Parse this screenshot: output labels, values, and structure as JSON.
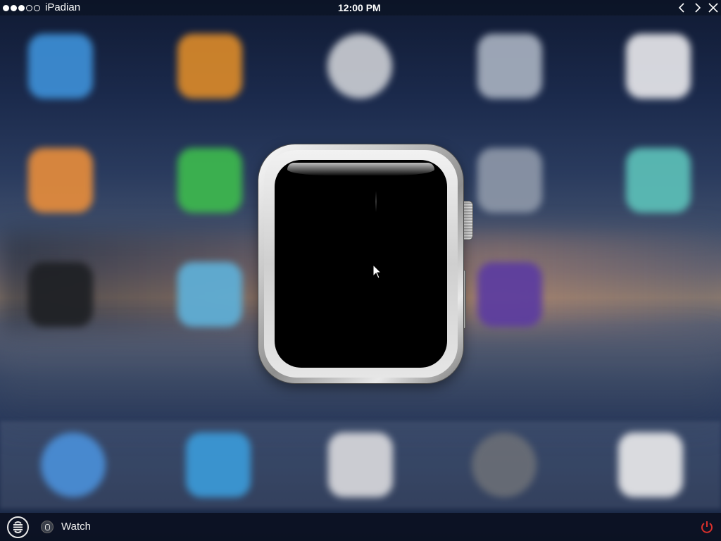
{
  "status_bar": {
    "signal_dots": [
      true,
      true,
      true,
      false,
      false
    ],
    "carrier": "iPadian",
    "time": "12:00 PM",
    "controls": [
      "chevron-left-icon",
      "chevron-right-icon",
      "close-icon"
    ]
  },
  "home_screen": {
    "icons": [
      {
        "name": "app-store-icon",
        "color": "#3d8fd6",
        "shape": "rounded"
      },
      {
        "name": "ibooks-icon",
        "color": "#d9892a",
        "shape": "rounded"
      },
      {
        "name": "clock-icon",
        "color": "#c9ccd2",
        "shape": "round"
      },
      {
        "name": "settings-icon",
        "color": "#a7b0bf",
        "shape": "rounded"
      },
      {
        "name": "health-icon",
        "color": "#e6e6ea",
        "shape": "rounded"
      },
      {
        "name": "mail-orange-icon",
        "color": "#e58c3c",
        "shape": "rounded"
      },
      {
        "name": "messages-icon",
        "color": "#3db94e",
        "shape": "rounded"
      },
      {
        "name": "blank-icon",
        "color": "#8d97a8",
        "shape": "rounded"
      },
      {
        "name": "clips-icon",
        "color": "#5cc0b8",
        "shape": "rounded"
      },
      {
        "name": "camera-icon",
        "color": "#1e2024",
        "shape": "rounded"
      },
      {
        "name": "weather-icon",
        "color": "#5fb0d8",
        "shape": "rounded"
      },
      {
        "name": "cloud-app-icon",
        "color": "#5c3ca0",
        "shape": "rounded"
      }
    ],
    "dock": [
      {
        "name": "safari-icon",
        "color": "#4a8fd8",
        "shape": "round"
      },
      {
        "name": "mail-icon",
        "color": "#3b9ad8",
        "shape": "rounded"
      },
      {
        "name": "apps-icon",
        "color": "#d8d8dc",
        "shape": "rounded"
      },
      {
        "name": "music-icon",
        "color": "#6a6e76",
        "shape": "round"
      },
      {
        "name": "photos-icon",
        "color": "#e8e8ea",
        "shape": "rounded"
      }
    ]
  },
  "taskbar": {
    "app_name": "Watch",
    "colors": {
      "power": "#d9302c"
    }
  }
}
